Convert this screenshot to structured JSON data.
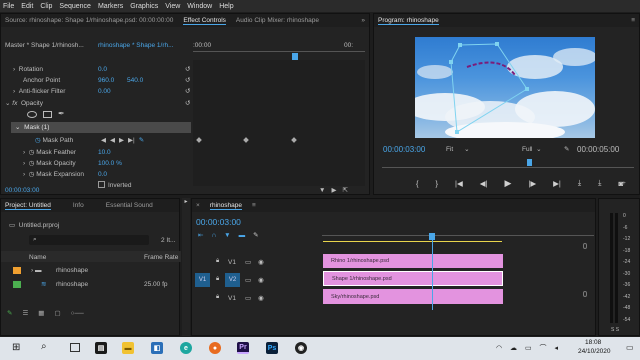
{
  "menu": [
    "File",
    "Edit",
    "Clip",
    "Sequence",
    "Markers",
    "Graphics",
    "View",
    "Window",
    "Help"
  ],
  "source_tabs": {
    "source": "Source: rhinoshape: Shape 1/rhinoshape.psd: 00:00:00:00",
    "effect_controls": "Effect Controls",
    "audio_mixer": "Audio Clip Mixer: rhinoshape"
  },
  "effect_controls": {
    "master": "Master * Shape 1/rhinosh...",
    "clip": "rhinoshape * Shape 1/rh...",
    "ruler_time": ":00:00",
    "ruler_end": "00:",
    "rotation": {
      "label": "Rotation",
      "value": "0.0"
    },
    "anchor": {
      "label": "Anchor Point",
      "x": "960.0",
      "y": "540.0"
    },
    "antiflicker": {
      "label": "Anti-flicker Filter",
      "value": "0.00"
    },
    "opacity": "Opacity",
    "fx": "fx",
    "mask": "Mask (1)",
    "mask_path": "Mask Path",
    "feather": {
      "label": "Mask Feather",
      "value": "10.0"
    },
    "mask_opacity": {
      "label": "Mask Opacity",
      "value": "100.0 %"
    },
    "expansion": {
      "label": "Mask Expansion",
      "value": "0.0"
    },
    "inverted": "Inverted",
    "timecode": "00:00:03:00"
  },
  "program": {
    "title": "Program: rhinoshape",
    "timecode": "00:00:03:00",
    "fit": "Fit",
    "quality": "Full",
    "duration": "00:00:05:00"
  },
  "project": {
    "tabs": [
      "Project: Untitled",
      "Info",
      "Essential Sound"
    ],
    "file": "Untitled.prproj",
    "count": "2 It...",
    "col_name": "Name",
    "col_rate": "Frame Rate",
    "items": [
      {
        "name": "rhinoshape",
        "rate": "",
        "color": "#f0a030"
      },
      {
        "name": "rhinoshape",
        "rate": "25.00 fp",
        "color": "#4caf50"
      }
    ]
  },
  "timeline": {
    "title": "rhinoshape",
    "timecode": "00:00:03:00",
    "tracks": [
      {
        "label": "V1",
        "clip": "Rhino 1/rhinoshape.psd"
      },
      {
        "label": "V2",
        "clip": "Shape 1/rhinoshape.psd"
      },
      {
        "label": "V1",
        "clip": "Sky/rhinoshape.psd"
      }
    ],
    "source_patch": "V1"
  },
  "meter_labels": [
    "0",
    "-6",
    "-12",
    "-18",
    "-24",
    "-30",
    "-36",
    "-42",
    "-48",
    "-54"
  ],
  "meter_bottom": "S  S",
  "taskbar": {
    "time": "18:08",
    "date": "24/10/2020",
    "search": "⌕"
  },
  "colors": {
    "accent": "#4aa6e8",
    "clip": "#e393df",
    "clip_selected_border": "#ffffff",
    "playhead": "#4aa6e8"
  }
}
